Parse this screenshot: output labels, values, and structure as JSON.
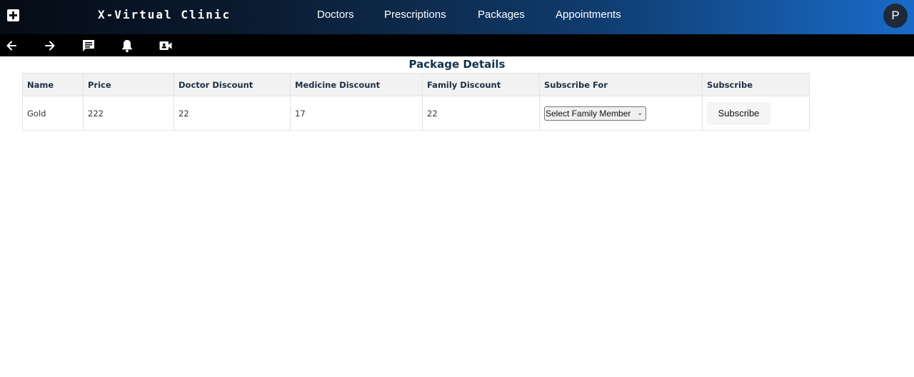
{
  "header": {
    "brand": "X-Virtual Clinic",
    "nav": [
      "Doctors",
      "Prescriptions",
      "Packages",
      "Appointments"
    ],
    "avatar_initial": "P"
  },
  "toolbar": {
    "icons": [
      "back-arrow-icon",
      "forward-arrow-icon",
      "chat-icon",
      "bell-icon",
      "video-call-icon"
    ]
  },
  "page": {
    "title": "Package Details"
  },
  "table": {
    "columns": [
      "Name",
      "Price",
      "Doctor Discount",
      "Medicine Discount",
      "Family Discount",
      "Subscribe For",
      "Subscribe"
    ],
    "rows": [
      {
        "name": "Gold",
        "price": "222",
        "doctor_discount": "22",
        "medicine_discount": "17",
        "family_discount": "22",
        "subscribe_for": "Select Family Member",
        "subscribe_label": "Subscribe"
      }
    ]
  }
}
